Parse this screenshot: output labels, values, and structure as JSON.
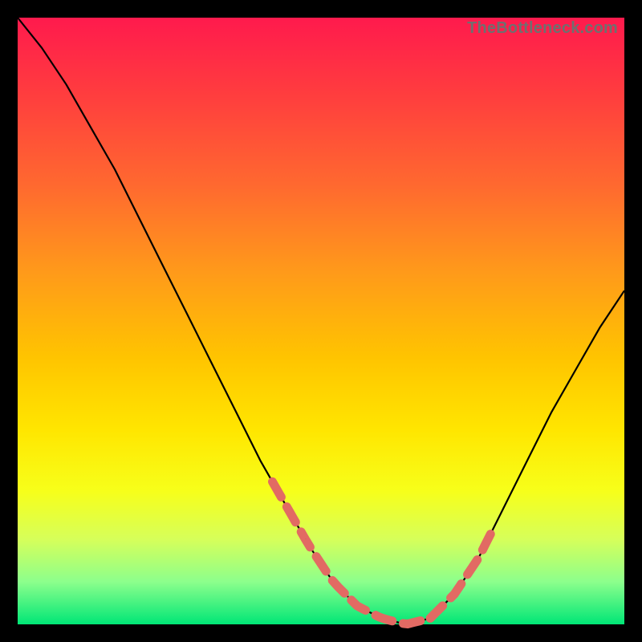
{
  "watermark": "TheBottleneck.com",
  "colors": {
    "frame_bg": "#000000",
    "gradient_top": "#ff1a4d",
    "gradient_bottom": "#00e676",
    "curve_stroke": "#000000",
    "highlight_stroke": "#e26a63"
  },
  "chart_data": {
    "type": "line",
    "title": "",
    "xlabel": "",
    "ylabel": "",
    "xlim": [
      0,
      100
    ],
    "ylim": [
      0,
      100
    ],
    "series": [
      {
        "name": "bottleneck-curve",
        "x": [
          0,
          4,
          8,
          12,
          16,
          20,
          24,
          28,
          32,
          36,
          40,
          44,
          48,
          52,
          56,
          60,
          64,
          68,
          72,
          76,
          80,
          84,
          88,
          92,
          96,
          100
        ],
        "y": [
          100,
          95,
          89,
          82,
          75,
          67,
          59,
          51,
          43,
          35,
          27,
          20,
          13,
          7,
          3,
          1,
          0,
          1,
          5,
          11,
          19,
          27,
          35,
          42,
          49,
          55
        ]
      }
    ],
    "highlight_ranges": [
      {
        "name": "left-slope",
        "x_start": 42,
        "x_end": 55
      },
      {
        "name": "valley",
        "x_start": 55,
        "x_end": 68
      },
      {
        "name": "right-slope",
        "x_start": 68,
        "x_end": 78
      }
    ],
    "annotations": []
  }
}
